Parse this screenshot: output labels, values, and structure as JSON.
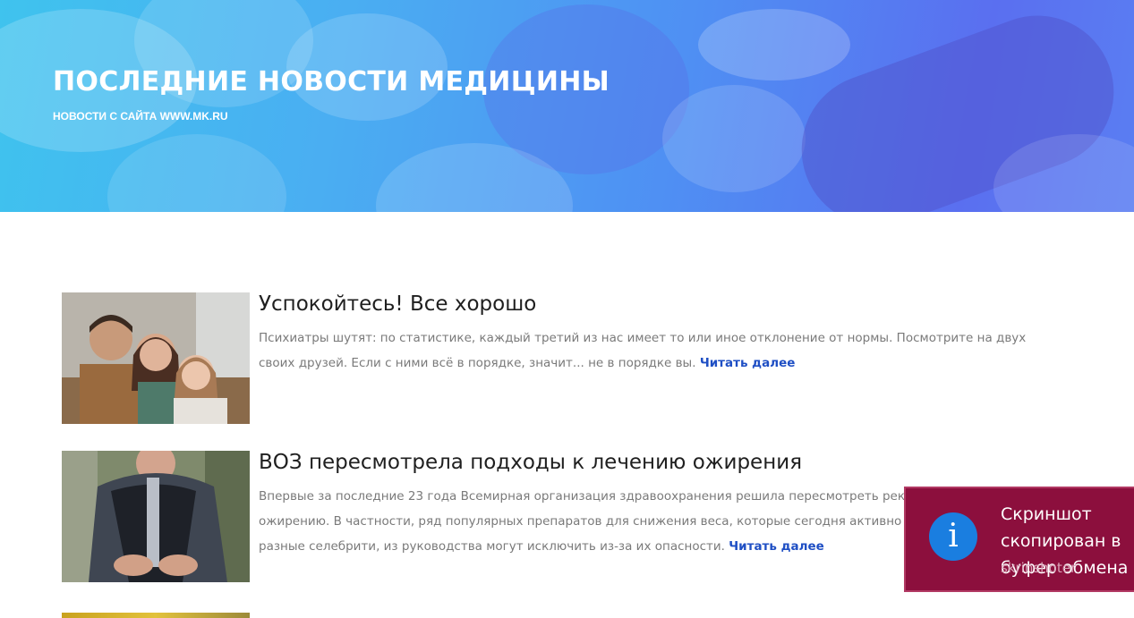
{
  "hero": {
    "title": "ПОСЛЕДНИЕ НОВОСТИ МЕДИЦИНЫ",
    "subtitle": "НОВОСТИ С САЙТА WWW.MK.RU"
  },
  "articles": [
    {
      "title": "Успокойтесь! Все хорошо",
      "text": "Психиатры шутят: по статистике, каждый третий из нас имеет то или иное отклонение от нормы. Посмотрите на двух своих друзей. Если с ними всё в порядке, значит... не в порядке вы.",
      "read_more": "Читать далее"
    },
    {
      "title": "ВОЗ пересмотрела подходы к лечению ожирения",
      "text": "Впервые за последние 23 года Всемирная организация здравоохранения решила пересмотреть рекомендации по ожирению. В частности, ряд популярных препаратов для снижения веса, которые сегодня активно рекламируют разные селебрити, из руководства могут исключить из-за их опасности.",
      "read_more": "Читать далее"
    }
  ],
  "toast": {
    "icon": "info-icon",
    "title": "Скриншот скопирован в буфер обмена",
    "app": "skrinshoter"
  },
  "colors": {
    "accent_link": "#1f4fc4",
    "toast_bg": "#8c0f3d",
    "toast_icon_bg": "#1a7ee0"
  }
}
